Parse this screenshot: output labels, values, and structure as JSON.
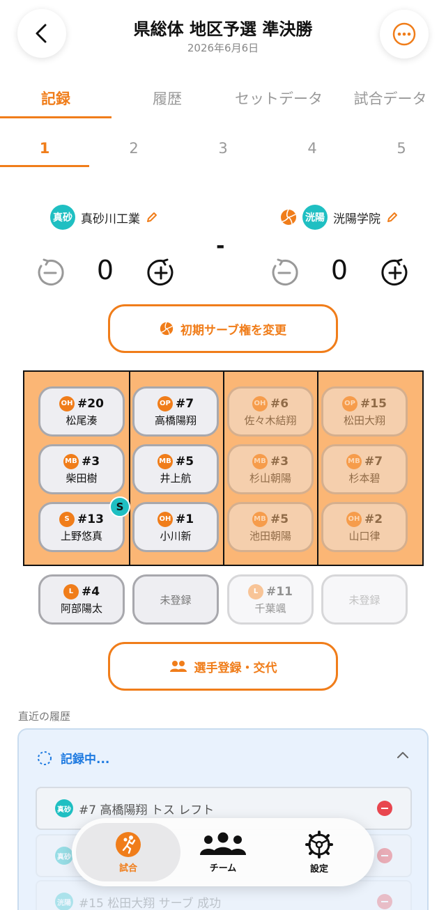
{
  "header": {
    "title": "県総体 地区予選 準決勝",
    "date": "2026年6月6日"
  },
  "tabs": [
    "記録",
    "履歴",
    "セットデータ",
    "試合データ"
  ],
  "sets": [
    "1",
    "2",
    "3",
    "4",
    "5"
  ],
  "teams": {
    "home": {
      "badge": "真砂",
      "name": "真砂川工業",
      "score": "0"
    },
    "away": {
      "badge": "洸陽",
      "name": "洸陽学院",
      "score": "0"
    },
    "separator": "-"
  },
  "serve_button_label": "初期サーブ権を変更",
  "court": {
    "home_rows": [
      [
        {
          "pos": "OH",
          "num": "#20",
          "name": "松尾湊"
        },
        {
          "pos": "OP",
          "num": "#7",
          "name": "高橋陽翔"
        }
      ],
      [
        {
          "pos": "MB",
          "num": "#3",
          "name": "柴田樹"
        },
        {
          "pos": "MB",
          "num": "#5",
          "name": "井上航"
        }
      ],
      [
        {
          "pos": "S",
          "num": "#13",
          "name": "上野悠真"
        },
        {
          "pos": "OH",
          "num": "#1",
          "name": "小川新"
        }
      ]
    ],
    "away_rows": [
      [
        {
          "pos": "OH",
          "num": "#6",
          "name": "佐々木結翔"
        },
        {
          "pos": "OP",
          "num": "#15",
          "name": "松田大翔"
        }
      ],
      [
        {
          "pos": "MB",
          "num": "#3",
          "name": "杉山朝陽"
        },
        {
          "pos": "MB",
          "num": "#7",
          "name": "杉本碧"
        }
      ],
      [
        {
          "pos": "MB",
          "num": "#5",
          "name": "池田朝陽"
        },
        {
          "pos": "OH",
          "num": "#2",
          "name": "山口律"
        }
      ]
    ],
    "setter_mark": "S"
  },
  "liberos": {
    "home": {
      "pos": "L",
      "num": "#4",
      "name": "阿部陽太"
    },
    "home_slot2": "未登録",
    "away": {
      "pos": "L",
      "num": "#11",
      "name": "千葉颯"
    },
    "away_slot2": "未登録"
  },
  "register_button_label": "選手登録・交代",
  "history": {
    "label": "直近の履歴",
    "recording": "記録中...",
    "items": [
      {
        "badge": "真砂",
        "text": "#7 高橋陽翔 トス レフト"
      },
      {
        "badge": "真砂",
        "text": ""
      },
      {
        "badge": "洸陽",
        "text": "#15 松田大翔 サーブ 成功"
      }
    ]
  },
  "nav": {
    "items": [
      "試合",
      "チーム",
      "設定"
    ]
  },
  "colors": {
    "accent": "#f07d1a",
    "team_badge": "#1fbfc2",
    "court": "#fbb675",
    "recording": "#1e7ae0",
    "remove": "#e8464f"
  }
}
